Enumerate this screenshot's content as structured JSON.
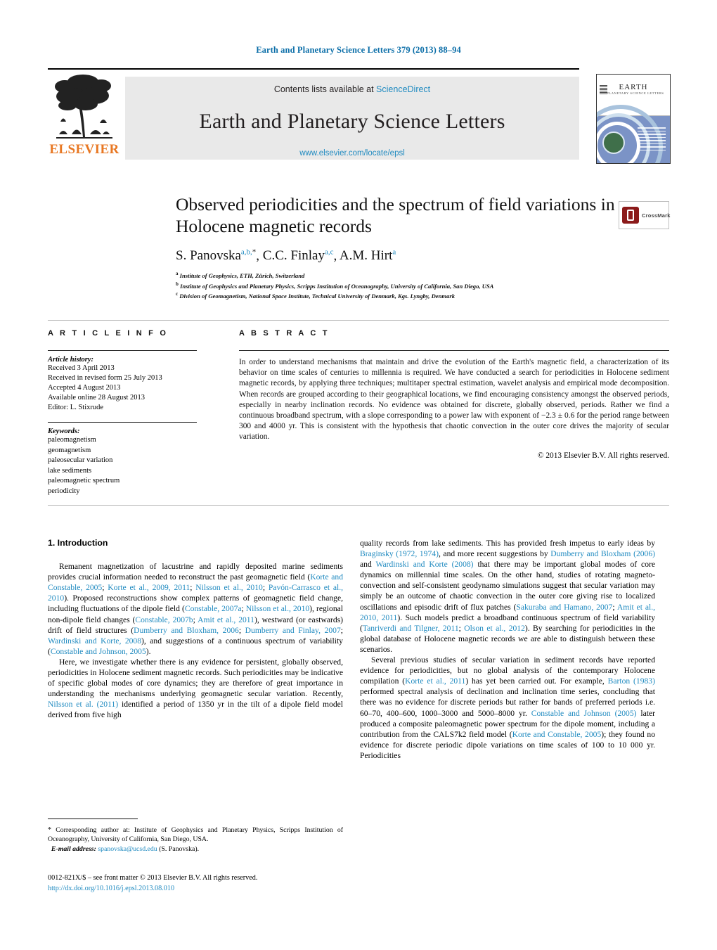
{
  "running_head": "Earth and Planetary Science Letters 379 (2013) 88–94",
  "masthead": {
    "publisher_name": "ELSEVIER",
    "contents_prefix": "Contents lists available at ",
    "sciencedirect": "ScienceDirect",
    "journal_title": "Earth and Planetary Science Letters",
    "journal_url": "www.elsevier.com/locate/epsl",
    "cover_title": "EARTH",
    "cover_subtitle": "& PLANETARY SCIENCE LETTERS"
  },
  "crossmark": {
    "label": "CrossMark"
  },
  "article": {
    "title": "Observed periodicities and the spectrum of field variations in Holocene magnetic records",
    "authors": [
      {
        "name": "S. Panovska",
        "sup": "a,b,",
        "star": "*"
      },
      {
        "name": "C.C. Finlay",
        "sup": "a,c",
        "star": ""
      },
      {
        "name": "A.M. Hirt",
        "sup": "a",
        "star": ""
      }
    ],
    "affiliations": [
      {
        "mark": "a",
        "text": "Institute of Geophysics, ETH, Zürich, Switzerland"
      },
      {
        "mark": "b",
        "text": "Institute of Geophysics and Planetary Physics, Scripps Institution of Oceanography, University of California, San Diego, USA"
      },
      {
        "mark": "c",
        "text": "Division of Geomagnetism, National Space Institute, Technical University of Denmark, Kgs. Lyngby, Denmark"
      }
    ]
  },
  "headings": {
    "article_info": "A R T I C L E   I N F O",
    "abstract": "A B S T R A C T"
  },
  "article_info": {
    "history_label": "Article history:",
    "history": [
      "Received 3 April 2013",
      "Received in revised form 25 July 2013",
      "Accepted 4 August 2013",
      "Available online 28 August 2013",
      "Editor: L. Stixrude"
    ],
    "keywords_label": "Keywords:",
    "keywords": [
      "paleomagnetism",
      "geomagnetism",
      "paleosecular variation",
      "lake sediments",
      "paleomagnetic spectrum",
      "periodicity"
    ]
  },
  "abstract": {
    "text": "In order to understand mechanisms that maintain and drive the evolution of the Earth's magnetic field, a characterization of its behavior on time scales of centuries to millennia is required. We have conducted a search for periodicities in Holocene sediment magnetic records, by applying three techniques; multitaper spectral estimation, wavelet analysis and empirical mode decomposition. When records are grouped according to their geographical locations, we find encouraging consistency amongst the observed periods, especially in nearby inclination records. No evidence was obtained for discrete, globally observed, periods. Rather we find a continuous broadband spectrum, with a slope corresponding to a power law with exponent of −2.3 ± 0.6 for the period range between 300 and 4000 yr. This is consistent with the hypothesis that chaotic convection in the outer core drives the majority of secular variation.",
    "copyright": "© 2013 Elsevier B.V. All rights reserved."
  },
  "body": {
    "section_number_title": "1. Introduction",
    "left_paragraphs": [
      "Remanent magnetization of lacustrine and rapidly deposited marine sediments provides crucial information needed to reconstruct the past geomagnetic field (Korte and Constable, 2005; Korte et al., 2009, 2011; Nilsson et al., 2010; Pavón-Carrasco et al., 2010). Proposed reconstructions show complex patterns of geomagnetic field change, including fluctuations of the dipole field (Constable, 2007a; Nilsson et al., 2010), regional non-dipole field changes (Constable, 2007b; Amit et al., 2011), westward (or eastwards) drift of field structures (Dumberry and Bloxham, 2006; Dumberry and Finlay, 2007; Wardinski and Korte, 2008), and suggestions of a continuous spectrum of variability (Constable and Johnson, 2005).",
      "Here, we investigate whether there is any evidence for persistent, globally observed, periodicities in Holocene sediment magnetic records. Such periodicities may be indicative of specific global modes of core dynamics; they are therefore of great importance in understanding the mechanisms underlying geomagnetic secular variation. Recently, Nilsson et al. (2011) identified a period of 1350 yr in the tilt of a dipole field model derived from five high"
    ],
    "right_paragraphs": [
      "quality records from lake sediments. This has provided fresh impetus to early ideas by Braginsky (1972, 1974), and more recent suggestions by Dumberry and Bloxham (2006) and Wardinski and Korte (2008) that there may be important global modes of core dynamics on millennial time scales. On the other hand, studies of rotating magneto-convection and self-consistent geodynamo simulations suggest that secular variation may simply be an outcome of chaotic convection in the outer core giving rise to localized oscillations and episodic drift of flux patches (Sakuraba and Hamano, 2007; Amit et al., 2010, 2011). Such models predict a broadband continuous spectrum of field variability (Tanriverdi and Tilgner, 2011; Olson et al., 2012). By searching for periodicities in the global database of Holocene magnetic records we are able to distinguish between these scenarios.",
      "Several previous studies of secular variation in sediment records have reported evidence for periodicities, but no global analysis of the contemporary Holocene compilation (Korte et al., 2011) has yet been carried out. For example, Barton (1983) performed spectral analysis of declination and inclination time series, concluding that there was no evidence for discrete periods but rather for bands of preferred periods i.e. 60–70, 400–600, 1000–3000 and 5000–8000 yr. Constable and Johnson (2005) later produced a composite paleomagnetic power spectrum for the dipole moment, including a contribution from the CALS7k2 field model (Korte and Constable, 2005); they found no evidence for discrete periodic dipole variations on time scales of 100 to 10 000 yr. Periodicities"
    ],
    "citations_left": [
      "Korte and Constable, 2005",
      "Korte et al., 2009, 2011",
      "Nilsson et al., 2010",
      "Pavón-Carrasco et al., 2010",
      "Constable, 2007a",
      "Constable, 2007b",
      "Amit et al., 2011",
      "Dumberry and Bloxham, 2006",
      "Dumberry and Finlay, 2007",
      "Wardinski and Korte, 2008",
      "Constable and Johnson, 2005",
      "Nilsson et al. (2011)"
    ],
    "citations_right": [
      "Braginsky (1972, 1974)",
      "Dumberry and Bloxham (2006)",
      "Wardinski and Korte (2008)",
      "Sakuraba and Hamano, 2007",
      "Amit et al., 2010, 2011",
      "Tanriverdi and Tilgner, 2011",
      "Olson et al., 2012",
      "Korte et al., 2011",
      "Barton (1983)",
      "Constable and Johnson (2005)",
      "Korte and Constable, 2005"
    ]
  },
  "footnote": {
    "star": "*",
    "text": "Corresponding author at: Institute of Geophysics and Planetary Physics, Scripps Institution of Oceanography, University of California, San Diego, USA.",
    "email_label": "E-mail address:",
    "email": "spanovska@ucsd.edu",
    "email_suffix": "(S. Panovska)."
  },
  "footer": {
    "issn_line": "0012-821X/$ – see front matter © 2013 Elsevier B.V. All rights reserved.",
    "doi": "http://dx.doi.org/10.1016/j.epsl.2013.08.010"
  },
  "colors": {
    "link": "#1f8ac0",
    "running_head": "#0b6ea8",
    "elsevier_orange": "#E87722",
    "crossmark_red": "#8B1A1A"
  }
}
